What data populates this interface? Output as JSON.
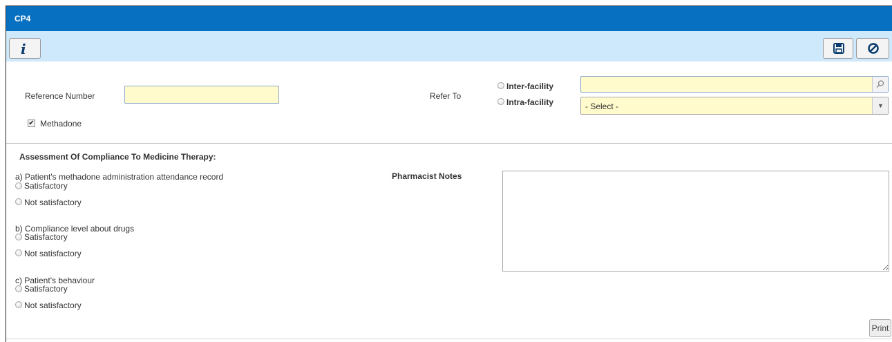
{
  "window": {
    "title": "CP4"
  },
  "toolbar": {
    "info_icon_glyph": "i",
    "save_icon": "floppy-disk-icon",
    "cancel_icon": "no-entry-icon"
  },
  "form": {
    "reference_number_label": "Reference Number",
    "reference_number_value": "",
    "methadone_label": "Methadone",
    "methadone_checked": true,
    "refer_to_label": "Refer To",
    "inter_facility_label": "Inter-facility",
    "intra_facility_label": "Intra-facility",
    "inter_facility_value": "",
    "intra_facility_select_value": "- Select -"
  },
  "assessment": {
    "heading": "Assessment Of Compliance To Medicine Therapy:",
    "questions": [
      {
        "label": "a) Patient's methadone administration attendance record",
        "options": [
          "Satisfactory",
          "Not satisfactory"
        ]
      },
      {
        "label": "b) Compliance level about drugs",
        "options": [
          "Satisfactory",
          "Not satisfactory"
        ]
      },
      {
        "label": "c) Patient's behaviour",
        "options": [
          "Satisfactory",
          "Not satisfactory"
        ]
      }
    ]
  },
  "notes": {
    "label": "Pharmacist Notes",
    "value": ""
  },
  "footer": {
    "print_label": "Print"
  },
  "colors": {
    "titlebar": "#0870c0",
    "toolbar": "#cde9fb",
    "input_fill": "#fffbcc"
  }
}
